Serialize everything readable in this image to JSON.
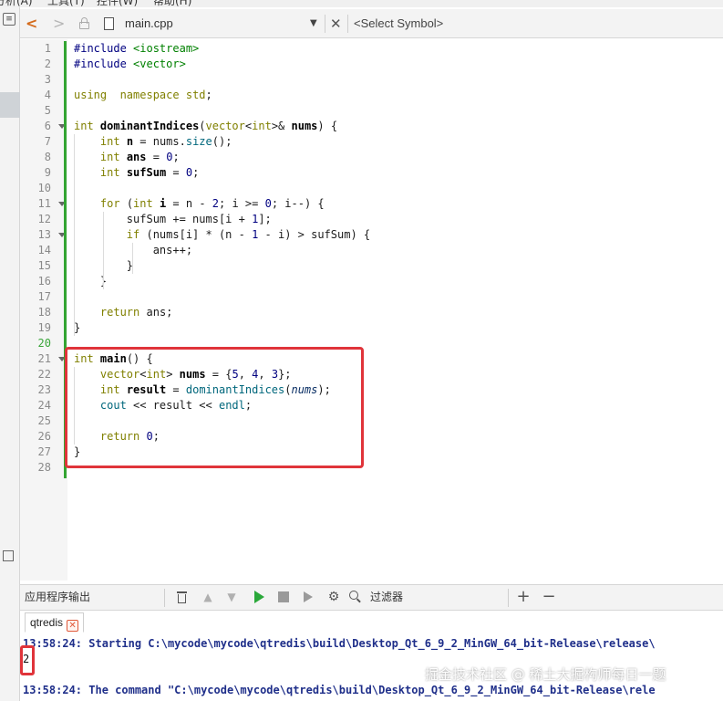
{
  "menubar": {
    "items": [
      "分析(A)",
      "工具(T)",
      "控件(W)",
      "帮助(H)"
    ]
  },
  "editor_toolbar": {
    "back_glyph": "<",
    "forward_glyph": ">",
    "file_name": "main.cpp",
    "file_dropdown_glyph": "▼",
    "close_glyph": "✕",
    "symbol_selector": "<Select Symbol>"
  },
  "editor": {
    "current_line": 20,
    "lines": [
      {
        "n": "1",
        "fold": false
      },
      {
        "n": "2",
        "fold": false
      },
      {
        "n": "3",
        "fold": false
      },
      {
        "n": "4",
        "fold": false
      },
      {
        "n": "5",
        "fold": false
      },
      {
        "n": "6",
        "fold": true
      },
      {
        "n": "7",
        "fold": false
      },
      {
        "n": "8",
        "fold": false
      },
      {
        "n": "9",
        "fold": false
      },
      {
        "n": "10",
        "fold": false
      },
      {
        "n": "11",
        "fold": true
      },
      {
        "n": "12",
        "fold": false
      },
      {
        "n": "13",
        "fold": true
      },
      {
        "n": "14",
        "fold": false
      },
      {
        "n": "15",
        "fold": false
      },
      {
        "n": "16",
        "fold": false
      },
      {
        "n": "17",
        "fold": false
      },
      {
        "n": "18",
        "fold": false
      },
      {
        "n": "19",
        "fold": false
      },
      {
        "n": "20",
        "fold": false
      },
      {
        "n": "21",
        "fold": true
      },
      {
        "n": "22",
        "fold": false
      },
      {
        "n": "23",
        "fold": false
      },
      {
        "n": "24",
        "fold": false
      },
      {
        "n": "25",
        "fold": false
      },
      {
        "n": "26",
        "fold": false
      },
      {
        "n": "27",
        "fold": false
      },
      {
        "n": "28",
        "fold": false
      }
    ],
    "code": [
      [
        [
          "pp",
          "#include "
        ],
        [
          "st",
          "<iostream>"
        ]
      ],
      [
        [
          "pp",
          "#include "
        ],
        [
          "st",
          "<vector>"
        ]
      ],
      [],
      [
        [
          "kw",
          "using"
        ],
        [
          "",
          "  "
        ],
        [
          "kw",
          "namespace"
        ],
        [
          "",
          " "
        ],
        [
          "kw",
          "std"
        ],
        [
          "",
          ";"
        ]
      ],
      [],
      [
        [
          "ty",
          "int"
        ],
        [
          "",
          " "
        ],
        [
          "bo",
          "dominantIndices"
        ],
        [
          "",
          "("
        ],
        [
          "ty",
          "vector"
        ],
        [
          "",
          "<"
        ],
        [
          "ty",
          "int"
        ],
        [
          "",
          ">& "
        ],
        [
          "bo",
          "nums"
        ],
        [
          "",
          ") {"
        ]
      ],
      [
        [
          "",
          "    "
        ],
        [
          "ty",
          "int"
        ],
        [
          "",
          " "
        ],
        [
          "bo",
          "n"
        ],
        [
          "",
          " = nums."
        ],
        [
          "fn",
          "size"
        ],
        [
          "",
          "();"
        ]
      ],
      [
        [
          "",
          "    "
        ],
        [
          "ty",
          "int"
        ],
        [
          "",
          " "
        ],
        [
          "bo",
          "ans"
        ],
        [
          "",
          " = "
        ],
        [
          "nu",
          "0"
        ],
        [
          "",
          ";"
        ]
      ],
      [
        [
          "",
          "    "
        ],
        [
          "ty",
          "int"
        ],
        [
          "",
          " "
        ],
        [
          "bo",
          "sufSum"
        ],
        [
          "",
          " = "
        ],
        [
          "nu",
          "0"
        ],
        [
          "",
          ";"
        ]
      ],
      [],
      [
        [
          "",
          "    "
        ],
        [
          "kw",
          "for"
        ],
        [
          "",
          " ("
        ],
        [
          "ty",
          "int"
        ],
        [
          "",
          " "
        ],
        [
          "bo",
          "i"
        ],
        [
          "",
          " = n - "
        ],
        [
          "nu",
          "2"
        ],
        [
          "",
          "; i >= "
        ],
        [
          "nu",
          "0"
        ],
        [
          "",
          "; i--) {"
        ]
      ],
      [
        [
          "",
          "        sufSum += nums[i + "
        ],
        [
          "nu",
          "1"
        ],
        [
          "",
          "];"
        ]
      ],
      [
        [
          "",
          "        "
        ],
        [
          "kw",
          "if"
        ],
        [
          "",
          " (nums[i] * (n - "
        ],
        [
          "nu",
          "1"
        ],
        [
          "",
          " - i) > sufSum) {"
        ]
      ],
      [
        [
          "",
          "            ans++;"
        ]
      ],
      [
        [
          "",
          "        }"
        ]
      ],
      [
        [
          "",
          "    }"
        ]
      ],
      [],
      [
        [
          "",
          "    "
        ],
        [
          "kw",
          "return"
        ],
        [
          "",
          " ans;"
        ]
      ],
      [
        [
          "",
          "}"
        ]
      ],
      [],
      [
        [
          "ty",
          "int"
        ],
        [
          "",
          " "
        ],
        [
          "bo",
          "main"
        ],
        [
          "",
          "() {"
        ]
      ],
      [
        [
          "",
          "    "
        ],
        [
          "ty",
          "vector"
        ],
        [
          "",
          "<"
        ],
        [
          "ty",
          "int"
        ],
        [
          "",
          "> "
        ],
        [
          "bo",
          "nums"
        ],
        [
          "",
          " = {"
        ],
        [
          "nu",
          "5"
        ],
        [
          "",
          ", "
        ],
        [
          "nu",
          "4"
        ],
        [
          "",
          ", "
        ],
        [
          "nu",
          "3"
        ],
        [
          "",
          "};"
        ]
      ],
      [
        [
          "",
          "    "
        ],
        [
          "ty",
          "int"
        ],
        [
          "",
          " "
        ],
        [
          "bo",
          "result"
        ],
        [
          "",
          " = "
        ],
        [
          "fn",
          "dominantIndices"
        ],
        [
          "",
          "("
        ],
        [
          "it",
          "nums"
        ],
        [
          "",
          ");"
        ]
      ],
      [
        [
          "",
          "    "
        ],
        [
          "fn",
          "cout"
        ],
        [
          "",
          " << result << "
        ],
        [
          "fn",
          "endl"
        ],
        [
          "",
          ";"
        ]
      ],
      [],
      [
        [
          "",
          "    "
        ],
        [
          "kw",
          "return"
        ],
        [
          "",
          " "
        ],
        [
          "nu",
          "0"
        ],
        [
          "",
          ";"
        ]
      ],
      [
        [
          "",
          "}"
        ]
      ],
      []
    ]
  },
  "output_panel": {
    "title": "应用程序输出",
    "filter_placeholder": "过滤器",
    "tab_label": "qtredis",
    "tab_close_glyph": "✕",
    "lines": [
      {
        "style": "blue",
        "text": "13:58:24: Starting C:\\mycode\\mycode\\qtredis\\build\\Desktop_Qt_6_9_2_MinGW_64_bit-Release\\release\\"
      },
      {
        "style": "plain",
        "text": "2"
      },
      {
        "style": "plain",
        "text": ""
      },
      {
        "style": "blue",
        "text": "13:58:24: The command \"C:\\mycode\\mycode\\qtredis\\build\\Desktop_Qt_6_9_2_MinGW_64_bit-Release\\rele"
      }
    ]
  },
  "watermark": "掘金技术社区 @ 稀土大掘构师每日一题",
  "colors": {
    "keyword": "#808000",
    "string": "#008000",
    "number": "#000080",
    "change_bar": "#33a532",
    "highlight_box": "#e0343a",
    "output_blue": "#1f2f8a"
  }
}
